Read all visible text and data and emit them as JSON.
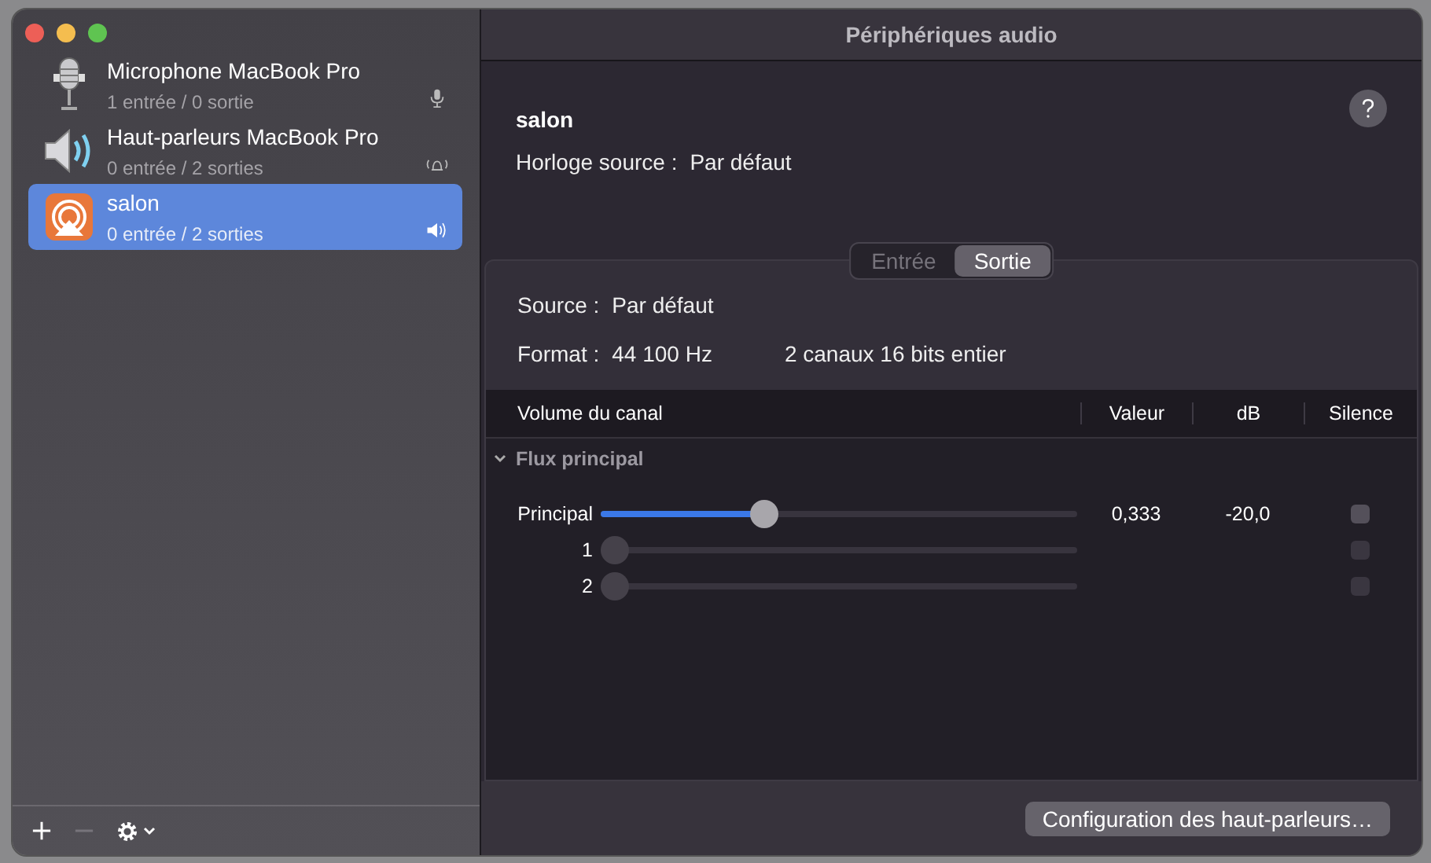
{
  "window": {
    "title": "Périphériques audio"
  },
  "devices": [
    {
      "kind": "microphone",
      "name": "Microphone MacBook Pro",
      "channels": "1 entrée / 0 sortie",
      "selected": false
    },
    {
      "kind": "speaker",
      "name": "Haut-parleurs MacBook Pro",
      "channels": "0 entrée / 2 sorties",
      "selected": false
    },
    {
      "kind": "airplay",
      "name": "salon",
      "channels": "0 entrée / 2 sorties",
      "selected": true
    }
  ],
  "toolbar": {
    "remove_disabled": true
  },
  "detail": {
    "name": "salon",
    "clock_label": "Horloge source :",
    "clock_value": "Par défaut",
    "tabs": [
      {
        "label": "Entrée",
        "selected": false
      },
      {
        "label": "Sortie",
        "selected": true
      }
    ],
    "source_label": "Source :",
    "source_value": "Par défaut",
    "format_label": "Format :",
    "format_rate": "44 100 Hz",
    "format_depth": "2 canaux 16 bits entier"
  },
  "table": {
    "columns": [
      "Volume du canal",
      "Valeur",
      "dB",
      "Silence"
    ],
    "group": {
      "label": "Flux principal",
      "expanded": true
    },
    "rows": [
      {
        "label": "Principal",
        "level": 0.333,
        "value": "0,333",
        "db": "-20,0",
        "muted": false,
        "disabled": false
      },
      {
        "label": "1",
        "level": 0,
        "muted": false,
        "disabled": true
      },
      {
        "label": "2",
        "level": 0,
        "muted": false,
        "disabled": true
      }
    ]
  },
  "buttons": [
    {
      "label": "Configuration des haut-parleurs…"
    }
  ]
}
